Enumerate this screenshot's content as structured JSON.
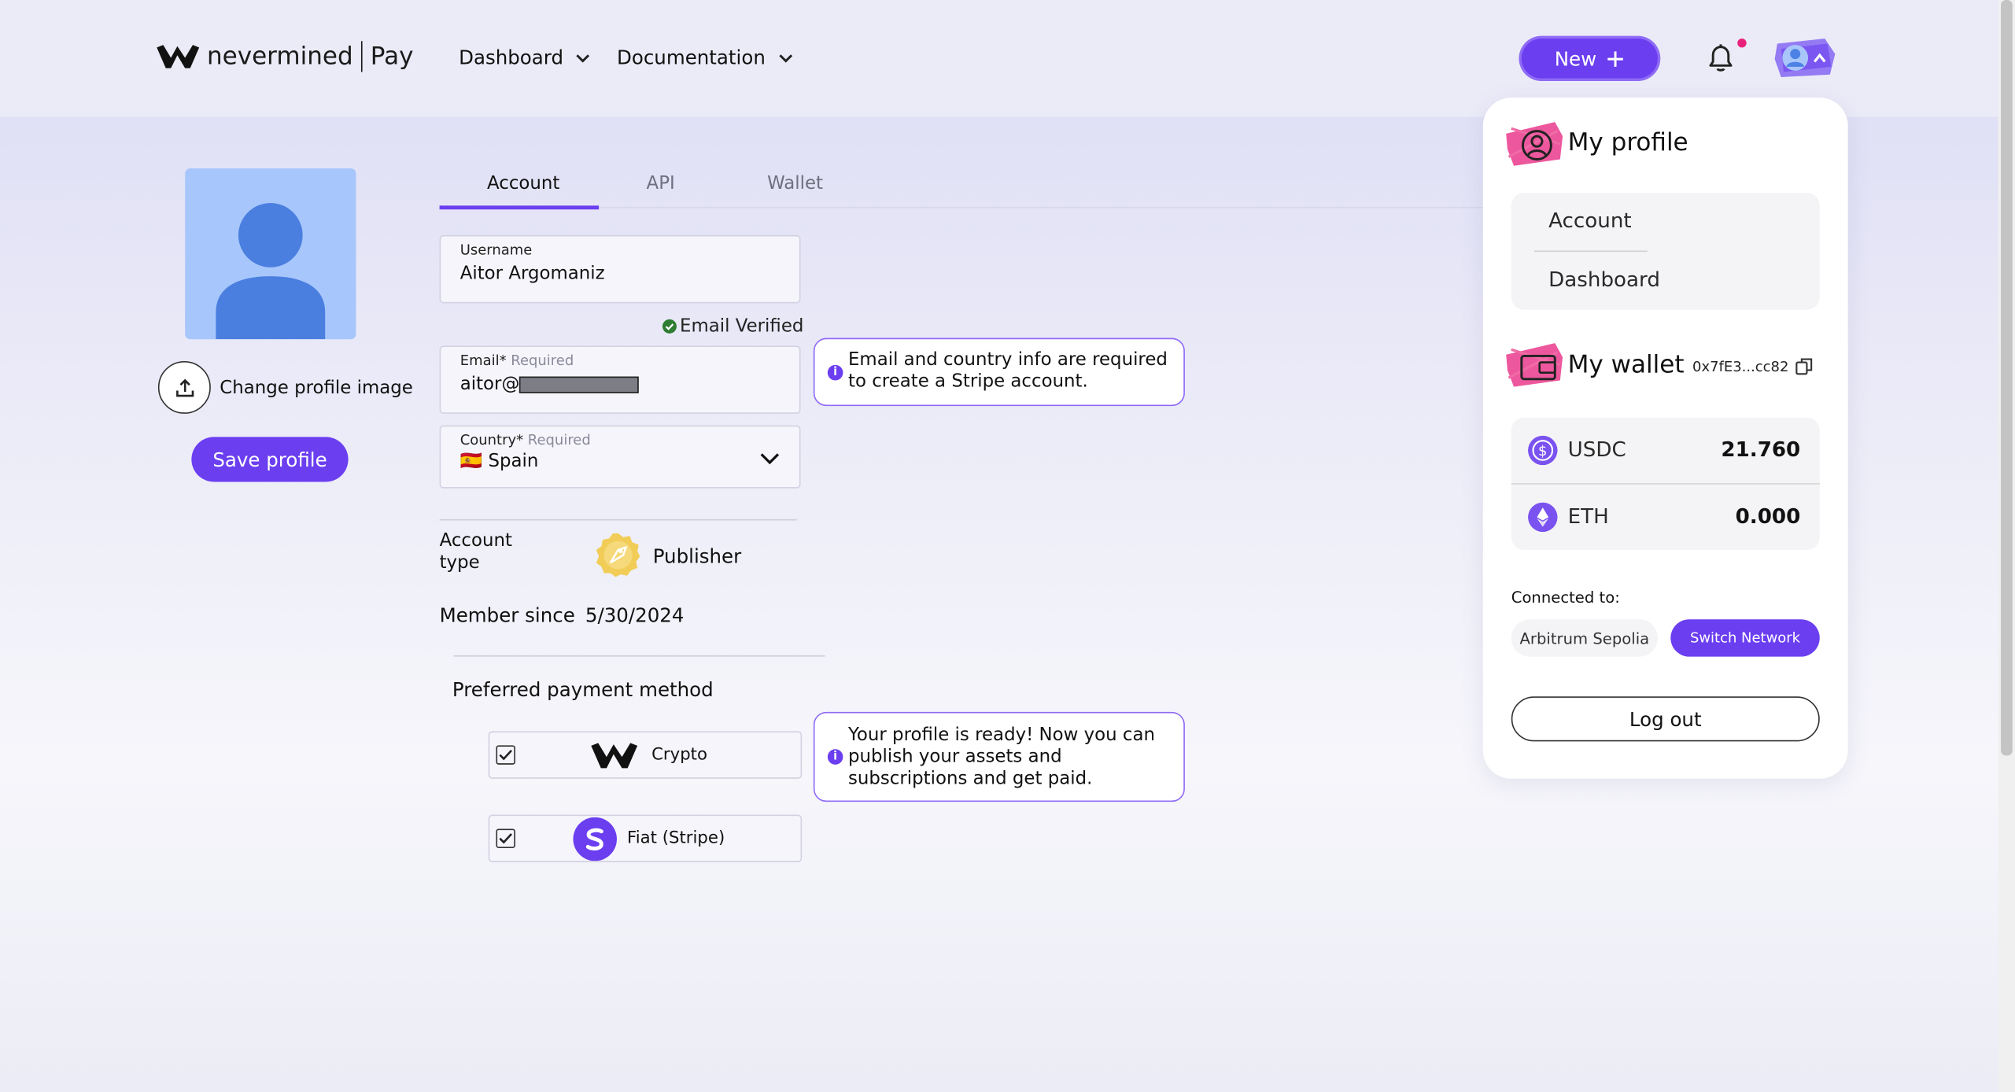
{
  "header": {
    "brand": "nevermined",
    "product": "Pay",
    "nav": [
      {
        "label": "Dashboard"
      },
      {
        "label": "Documentation"
      }
    ],
    "new_button": "New",
    "accent": "#6b3ef0",
    "notification_color": "#e8227a"
  },
  "profile": {
    "change_image_label": "Change profile image",
    "save_label": "Save profile"
  },
  "tabs": [
    {
      "label": "Account",
      "active": true
    },
    {
      "label": "API",
      "active": false
    },
    {
      "label": "Wallet",
      "active": false
    }
  ],
  "form": {
    "username": {
      "label": "Username",
      "value": "Aitor Argomaniz"
    },
    "email_verified": "Email Verified",
    "email": {
      "label": "Email*",
      "required": "Required",
      "value": "aitor@"
    },
    "country": {
      "label": "Country*",
      "required": "Required",
      "value": "Spain",
      "flag": "🇪🇸"
    },
    "email_info": "Email and country info are required to create a Stripe account.",
    "account_type_label": "Account type",
    "account_type_value": "Publisher",
    "member_since_label": "Member since",
    "member_since_value": "5/30/2024",
    "preferred_payment_label": "Preferred payment method",
    "payment_methods": [
      {
        "label": "Crypto",
        "checked": true
      },
      {
        "label": "Fiat (Stripe)",
        "checked": true
      }
    ],
    "ready_info": "Your profile is ready! Now you can publish your assets and subscriptions and get paid."
  },
  "dropdown": {
    "my_profile_title": "My profile",
    "menu": [
      {
        "label": "Account"
      },
      {
        "label": "Dashboard"
      }
    ],
    "my_wallet_title": "My wallet",
    "wallet_address": "0x7fE3...cc82",
    "balances": [
      {
        "symbol": "USDC",
        "amount": "21.760"
      },
      {
        "symbol": "ETH",
        "amount": "0.000"
      }
    ],
    "connected_label": "Connected to:",
    "network": "Arbitrum Sepolia",
    "switch_network": "Switch Network",
    "logout": "Log out"
  }
}
